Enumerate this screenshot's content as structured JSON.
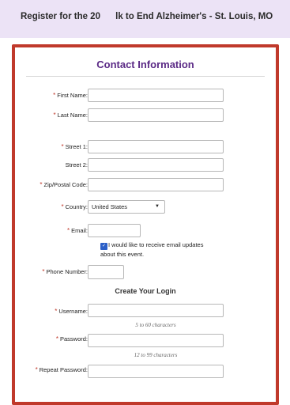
{
  "header": {
    "title": "Register for the 20      lk to End Alzheimer's - St. Louis, MO"
  },
  "contact": {
    "title": "Contact Information",
    "fields": {
      "first_name": "First Name:",
      "last_name": "Last Name:",
      "street1": "Street 1:",
      "street2": "Street 2:",
      "zip": "Zip/Postal Code:",
      "country": "Country:",
      "country_value": "United States",
      "email": "Email:",
      "email_updates_1": "I would like to receive email updates",
      "email_updates_2": "about this event.",
      "phone": "Phone Number:"
    }
  },
  "login": {
    "title": "Create Your Login",
    "username": "Username:",
    "username_hint": "5 to 60 characters",
    "password": "Password:",
    "password_hint": "12 to 99 characters",
    "repeat_password": "Repeat Password:"
  },
  "required_mark": "*"
}
